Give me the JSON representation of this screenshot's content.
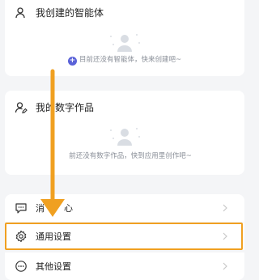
{
  "sections": [
    {
      "title": "我创建的智能体",
      "icon": "person-icon",
      "empty_text": "目前还没有智能体，快来创建吧~",
      "empty_icon": "empty-placeholder-icon",
      "action_icon": "plus-circle-icon"
    },
    {
      "title": "我的数字作品",
      "icon": "person-edit-icon",
      "empty_text": "前还没有数字作品，快到应用里创作吧~",
      "empty_icon": "empty-placeholder-icon"
    }
  ],
  "menu": [
    {
      "label": "消",
      "label_tail": "心",
      "icon": "message-icon"
    },
    {
      "label": "通用设置",
      "icon": "gear-icon"
    },
    {
      "label": "其他设置",
      "icon": "more-circle-icon"
    }
  ],
  "annotation": {
    "color": "#f0a021",
    "target": "通用设置"
  },
  "colors": {
    "accent": "#5a62d8",
    "background": "#f4f5f7",
    "muted_text": "#8a8f98",
    "chevron": "#c8c8c8"
  }
}
